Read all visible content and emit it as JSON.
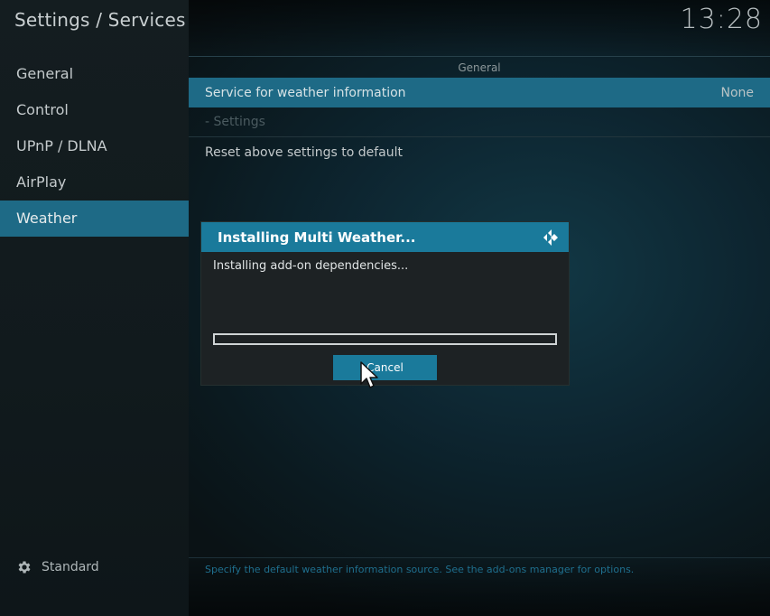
{
  "header": {
    "title": "Settings / Services",
    "clock": "13:28"
  },
  "sidebar": {
    "items": [
      {
        "label": "General"
      },
      {
        "label": "Control"
      },
      {
        "label": "UPnP / DLNA"
      },
      {
        "label": "AirPlay"
      },
      {
        "label": "Weather"
      }
    ],
    "active_index": 4,
    "profile_label": "Standard",
    "profile_icon": "gear-icon"
  },
  "content": {
    "section_header": "General",
    "rows": [
      {
        "label": "Service for weather information",
        "value": "None"
      },
      {
        "label": "- Settings"
      },
      {
        "label": "Reset above settings to default"
      }
    ],
    "hint": "Specify the default weather information source. See the add-ons manager for options."
  },
  "dialog": {
    "title": "Installing Multi Weather...",
    "message": "Installing add-on dependencies...",
    "progress_percent": 0,
    "cancel_label": "Cancel",
    "logo_icon": "kodi-logo-icon"
  },
  "colors": {
    "accent": "#1a7a9b",
    "active_item": "#1e6a86",
    "hint_text": "#1f6f8e"
  }
}
